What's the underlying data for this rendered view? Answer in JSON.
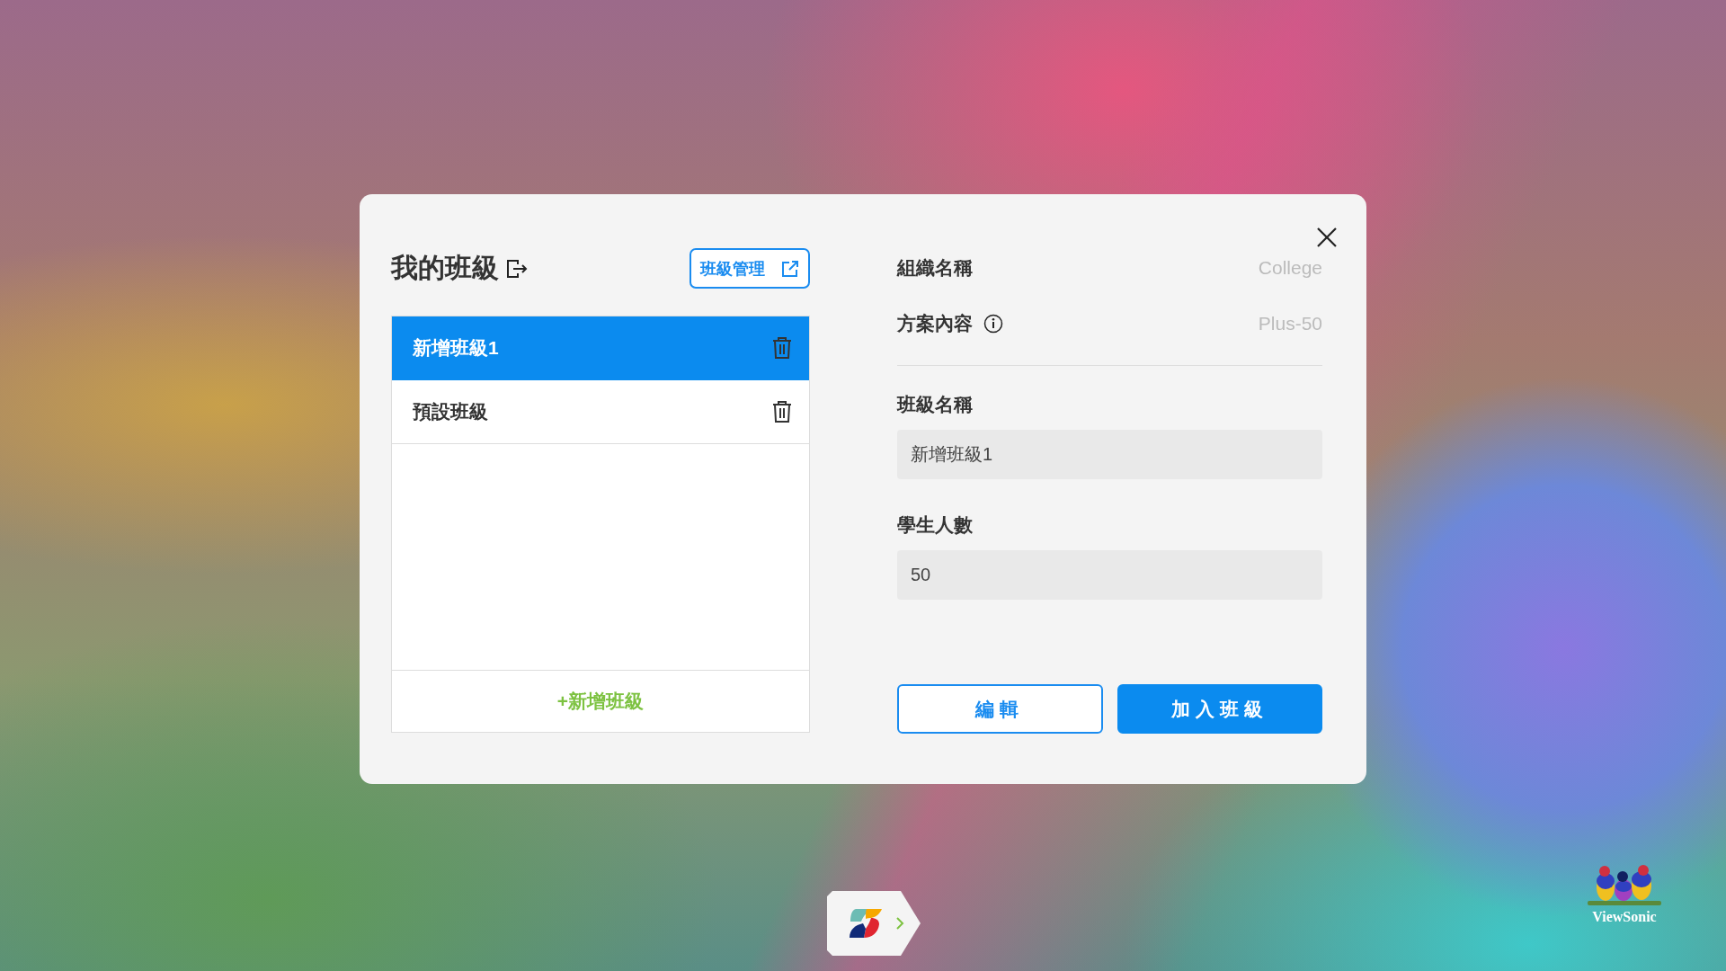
{
  "dialog": {
    "title": "我的班級",
    "manage_button": "班級管理",
    "classes": [
      {
        "name": "新增班級1",
        "selected": true
      },
      {
        "name": "預設班級",
        "selected": false
      }
    ],
    "add_class": "+新增班級",
    "details": [
      {
        "label": "組織名稱",
        "value": "College",
        "info": false
      },
      {
        "label": "方案內容",
        "value": "Plus-50",
        "info": true
      }
    ],
    "fields": [
      {
        "label": "班級名稱",
        "value": "新增班級1"
      },
      {
        "label": "學生人數",
        "value": "50"
      }
    ],
    "buttons": [
      {
        "label": "編輯",
        "kind": "outline"
      },
      {
        "label": "加入班級",
        "kind": "primary"
      }
    ]
  },
  "brand": {
    "name": "ViewSonic"
  }
}
